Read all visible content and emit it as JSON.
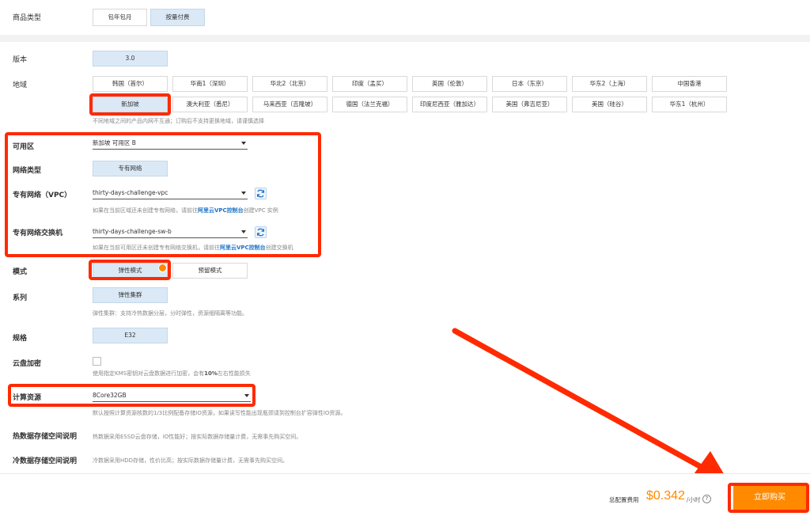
{
  "product_type": {
    "label": "商品类型",
    "options": [
      "包年包月",
      "按量付费"
    ],
    "selected": "按量付费"
  },
  "version": {
    "label": "版本",
    "value": "3.0"
  },
  "region": {
    "label": "地域",
    "row1": [
      "韩国（首尔）",
      "华南1（深圳）",
      "华北2（北京）",
      "印度（孟买）",
      "英国（伦敦）",
      "日本（东京）",
      "华东2（上海）",
      "中国香港"
    ],
    "row2": [
      "新加坡",
      "澳大利亚（悉尼）",
      "马来西亚（吉隆坡）",
      "德国（法兰克福）",
      "印度尼西亚（雅加达）",
      "美国（弗吉尼亚）",
      "美国（硅谷）",
      "华东1（杭州）"
    ],
    "selected": "新加坡",
    "hint": "不同地域之间的产品内网不互通；订购后不支持更换地域，请谨慎选择"
  },
  "zone": {
    "label": "可用区",
    "value": "新加坡 可用区 B"
  },
  "network_type": {
    "label": "网络类型",
    "value": "专有网络"
  },
  "vpc": {
    "label": "专有网络（VPC）",
    "value": "thirty-days-challenge-vpc",
    "hint_pre": "如果在当前区域还未创建专有网络，请前往",
    "hint_link": "阿里云VPC控制台",
    "hint_post": "创建VPC 实例"
  },
  "vswitch": {
    "label": "专有网络交换机",
    "value": "thirty-days-challenge-sw-b",
    "hint_pre": "如果在当前可用区还未创建专有网络交换机，请前往",
    "hint_link": "阿里云VPC控制台",
    "hint_post": "创建交换机"
  },
  "mode": {
    "label": "模式",
    "options": [
      "弹性模式",
      "预留模式"
    ],
    "selected": "弹性模式"
  },
  "series": {
    "label": "系列",
    "value": "弹性集群",
    "hint": "弹性集群：支持冷热数据分层，分时弹性，资源细隔离等功能。"
  },
  "spec": {
    "label": "规格",
    "value": "E32"
  },
  "disk_encryption": {
    "label": "云盘加密",
    "hint_pre": "使用指定KMS密钥对云盘数据进行加密，会有",
    "hint_bold": "10%",
    "hint_post": "左右性能损失"
  },
  "compute": {
    "label": "计算资源",
    "value": "8Core32GB",
    "hint": "默认按照计算资源核数的1/3比例配备存储IO资源，如果读写性能出现瓶颈请到控制台扩容弹性IO资源。"
  },
  "hot_storage": {
    "label": "热数据存储空间说明",
    "desc": "热数据采用ESSD云盘存储，IO性能好；按实际数据存储量计费，无需事先购买空间。"
  },
  "cold_storage": {
    "label": "冷数据存储空间说明",
    "desc": "冷数据采用HDD存储，性价比高；按实际数据存储量计费，无需事先购买空间。"
  },
  "footer": {
    "total_label": "总配置费用",
    "price": "$0.342",
    "unit": "/小时",
    "buy_label": "立即购买"
  },
  "colors": {
    "accent_orange": "#ff8a00",
    "annotation_red": "#ff2a00",
    "selected_bg": "#dbe9f6",
    "link_blue": "#1e74c9"
  }
}
